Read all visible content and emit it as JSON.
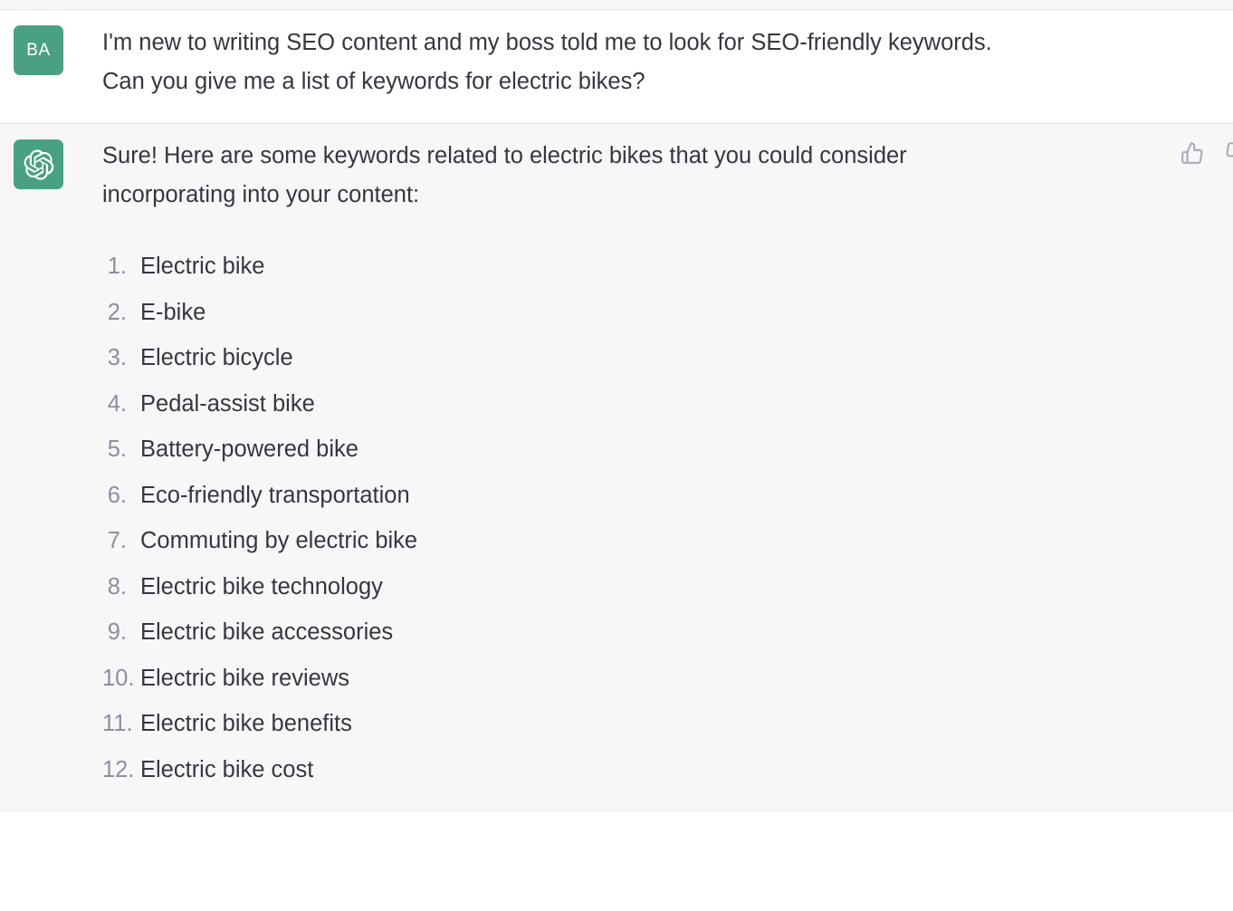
{
  "conversation": {
    "user_turn": {
      "avatar": {
        "initials": "BA",
        "name": "user-avatar",
        "color": "#4aa181"
      },
      "message_line_1": "I'm new to writing SEO content and my boss told me to look for SEO-friendly keywords.",
      "message_line_2": "Can you give me a list of keywords for electric bikes?"
    },
    "assistant_turn": {
      "avatar": {
        "icon": "openai-logo-icon",
        "color": "#4aa181"
      },
      "intro_line_1": "Sure! Here are some keywords related to electric bikes that you could consider",
      "intro_line_2": "incorporating into your content:",
      "keywords": [
        {
          "number": "1.",
          "text": "Electric bike"
        },
        {
          "number": "2.",
          "text": "E-bike"
        },
        {
          "number": "3.",
          "text": "Electric bicycle"
        },
        {
          "number": "4.",
          "text": "Pedal-assist bike"
        },
        {
          "number": "5.",
          "text": "Battery-powered bike"
        },
        {
          "number": "6.",
          "text": "Eco-friendly transportation"
        },
        {
          "number": "7.",
          "text": "Commuting by electric bike"
        },
        {
          "number": "8.",
          "text": "Electric bike technology"
        },
        {
          "number": "9.",
          "text": "Electric bike accessories"
        },
        {
          "number": "10.",
          "text": "Electric bike reviews"
        },
        {
          "number": "11.",
          "text": "Electric bike benefits"
        },
        {
          "number": "12.",
          "text": "Electric bike cost"
        }
      ],
      "actions": {
        "thumbs_up": "thumbs-up-icon",
        "thumbs_down": "thumbs-down-icon"
      }
    }
  },
  "colors": {
    "user_background": "#ffffff",
    "assistant_background": "#f7f7f8",
    "text": "#353740",
    "muted_text": "#8e8ea0",
    "icon": "#acacbe",
    "divider": "#e5e5e5"
  }
}
